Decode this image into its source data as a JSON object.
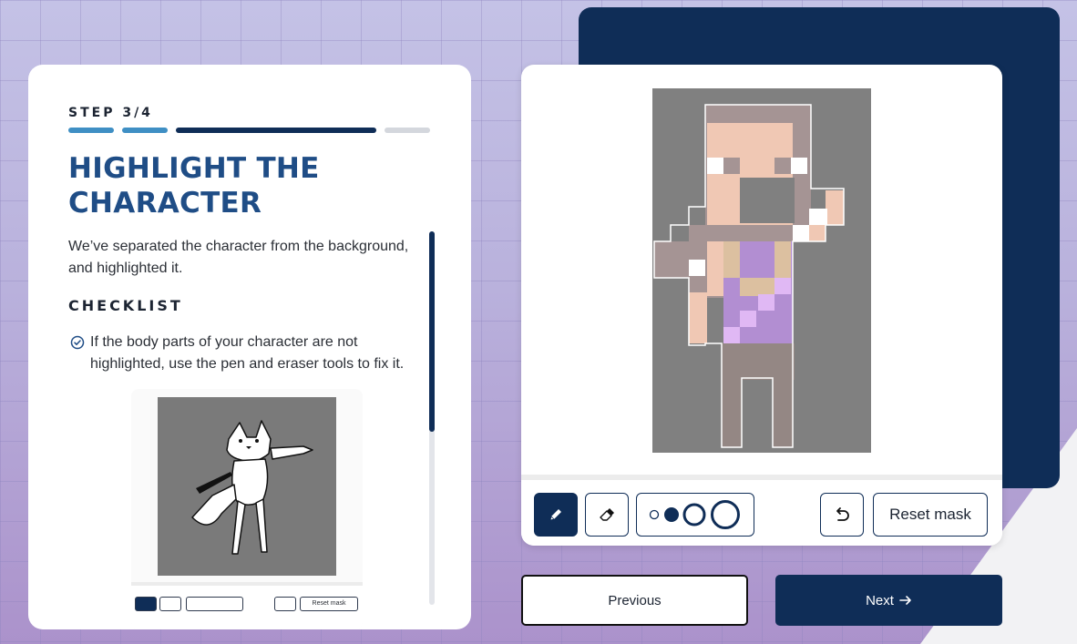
{
  "step": {
    "label": "STEP 3/4",
    "current": 3,
    "total": 4
  },
  "title": "HIGHLIGHT THE CHARACTER",
  "description": "We’ve separated the character from the background, and highlighted it.",
  "checklist": {
    "heading": "CHECKLIST",
    "items": [
      "If the body parts of your character are not highlighted, use the pen and eraser tools to fix it."
    ]
  },
  "demo": {
    "reset_label": "Reset mask"
  },
  "toolbar": {
    "pen_icon": "pencil-icon",
    "eraser_icon": "eraser-icon",
    "undo_icon": "undo-icon",
    "brush_sizes": [
      "small",
      "medium",
      "large",
      "x-large"
    ],
    "selected_brush": "medium",
    "reset_label": "Reset mask"
  },
  "nav": {
    "previous_label": "Previous",
    "next_label": "Next",
    "next_icon": "arrow-right-icon"
  },
  "colors": {
    "navy": "#0f2d57",
    "title_blue": "#1f4d86",
    "progress_done": "#3f8fc4",
    "progress_todo": "#d4d7dd"
  }
}
